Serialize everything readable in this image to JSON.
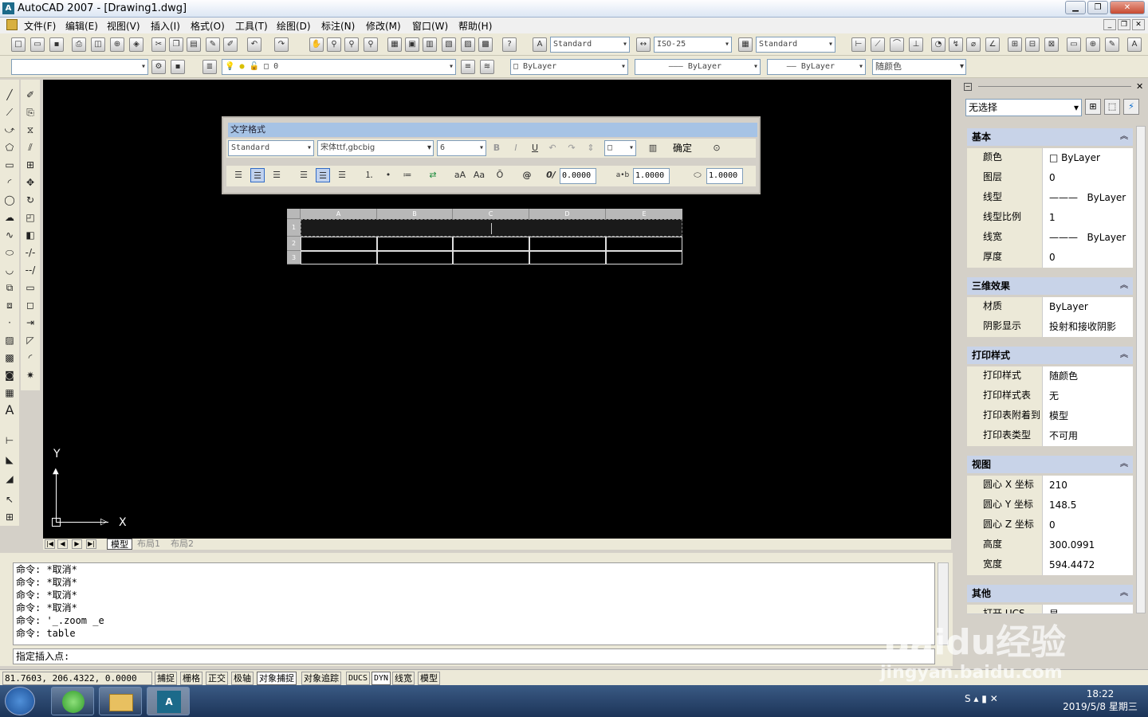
{
  "window": {
    "title": "AutoCAD 2007 - [Drawing1.dwg]"
  },
  "menu": [
    "文件(F)",
    "编辑(E)",
    "视图(V)",
    "插入(I)",
    "格式(O)",
    "工具(T)",
    "绘图(D)",
    "标注(N)",
    "修改(M)",
    "窗口(W)",
    "帮助(H)"
  ],
  "toolbar": {
    "text_style": "Standard",
    "dim_style": "ISO-25",
    "table_style": "Standard",
    "layer_value": "0",
    "color": "ByLayer",
    "linetype": "ByLayer",
    "lineweight": "ByLayer",
    "plotstyle": "随颜色"
  },
  "text_format": {
    "title": "文字格式",
    "style": "Standard",
    "font": "宋体ttf,gbcbig",
    "height": "6",
    "ok_label": "确定",
    "oblique": "0.0000",
    "tracking": "1.0000",
    "width_factor": "1.0000"
  },
  "table": {
    "columns": [
      "A",
      "B",
      "C",
      "D",
      "E"
    ],
    "rows": [
      "1",
      "2",
      "3"
    ]
  },
  "layout_tabs": [
    "模型",
    "布局1",
    "布局2"
  ],
  "ucs": {
    "x": "X",
    "y": "Y"
  },
  "command": {
    "history": [
      "命令: *取消*",
      "命令: *取消*",
      "命令: *取消*",
      "命令: *取消*",
      "命令: '_.zoom _e",
      "命令: table"
    ],
    "prompt": "指定插入点:"
  },
  "status": {
    "coords": "81.7603,  206.4322,  0.0000",
    "buttons": [
      "捕捉",
      "栅格",
      "正交",
      "极轴",
      "对象捕捉",
      "对象追踪",
      "DUCS",
      "DYN",
      "线宽",
      "模型"
    ]
  },
  "properties": {
    "selection": "无选择",
    "sections": [
      {
        "title": "基本",
        "rows": [
          [
            "颜色",
            "ByLayer"
          ],
          [
            "图层",
            "0"
          ],
          [
            "线型",
            "ByLayer"
          ],
          [
            "线型比例",
            "1"
          ],
          [
            "线宽",
            "ByLayer"
          ],
          [
            "厚度",
            "0"
          ]
        ]
      },
      {
        "title": "三维效果",
        "rows": [
          [
            "材质",
            "ByLayer"
          ],
          [
            "阴影显示",
            "投射和接收阴影"
          ]
        ]
      },
      {
        "title": "打印样式",
        "rows": [
          [
            "打印样式",
            "随颜色"
          ],
          [
            "打印样式表",
            "无"
          ],
          [
            "打印表附着到",
            "模型"
          ],
          [
            "打印表类型",
            "不可用"
          ]
        ]
      },
      {
        "title": "视图",
        "rows": [
          [
            "圆心 X 坐标",
            "210"
          ],
          [
            "圆心 Y 坐标",
            "148.5"
          ],
          [
            "圆心 Z 坐标",
            "0"
          ],
          [
            "高度",
            "300.0991"
          ],
          [
            "宽度",
            "594.4472"
          ]
        ]
      },
      {
        "title": "其他",
        "rows": [
          [
            "打开 UCS",
            "是"
          ]
        ]
      }
    ]
  },
  "taskbar": {
    "time": "18:22",
    "date": "2019/5/8 星期三"
  },
  "watermark": {
    "brand": "Baidu经验",
    "url": "jingyan.baidu.com"
  }
}
